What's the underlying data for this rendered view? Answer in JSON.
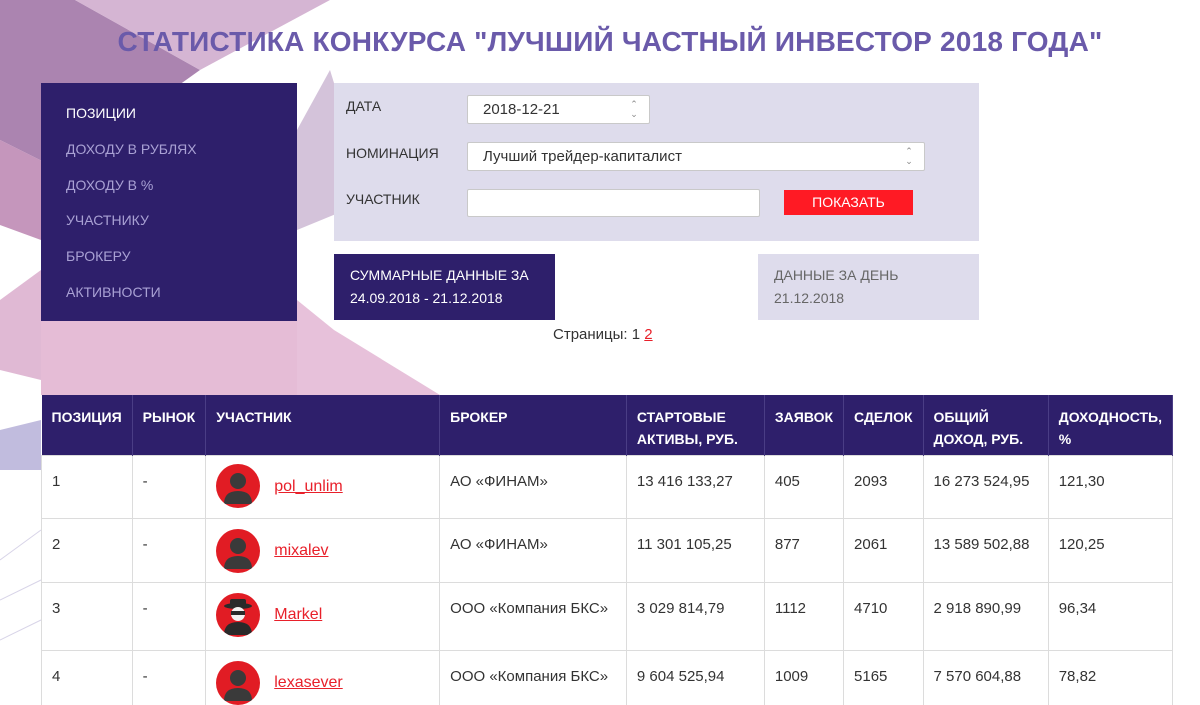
{
  "page_title": "СТАТИСТИКА КОНКУРСА \"ЛУЧШИЙ ЧАСТНЫЙ ИНВЕСТОР 2018 ГОДА\"",
  "sidebar": {
    "items": [
      {
        "label": "ПОЗИЦИИ",
        "active": true
      },
      {
        "label": "ДОХОДУ В РУБЛЯХ",
        "active": false
      },
      {
        "label": "ДОХОДУ В %",
        "active": false
      },
      {
        "label": "УЧАСТНИКУ",
        "active": false
      },
      {
        "label": "БРОКЕРУ",
        "active": false
      },
      {
        "label": "АКТИВНОСТИ",
        "active": false
      }
    ]
  },
  "filters": {
    "date_label": "ДАТА",
    "date_value": "2018-12-21",
    "nomination_label": "НОМИНАЦИЯ",
    "nomination_value": "Лучший трейдер-капиталист",
    "participant_label": "УЧАСТНИК",
    "participant_value": "",
    "show_button": "ПОКАЗАТЬ"
  },
  "tabs": {
    "summary_line1": "СУММАРНЫЕ ДАННЫЕ ЗА",
    "summary_line2": "24.09.2018 - 21.12.2018",
    "day_line1": "ДАННЫЕ ЗА ДЕНЬ",
    "day_line2": "21.12.2018"
  },
  "pager": {
    "label": "Страницы:",
    "current": "1",
    "other": "2"
  },
  "table": {
    "headers": {
      "position": "ПОЗИЦИЯ",
      "market": "РЫНОК",
      "participant": "УЧАСТНИК",
      "broker": "БРОКЕР",
      "start_assets": "СТАРТОВЫЕ АКТИВЫ, РУБ.",
      "orders": "ЗАЯВОК",
      "deals": "СДЕЛОК",
      "total_income": "ОБЩИЙ ДОХОД, РУБ.",
      "yield": "ДОХОДНОСТЬ, %"
    },
    "rows": [
      {
        "position": "1",
        "market": "-",
        "participant": "pol_unlim",
        "broker": "АО «ФИНАМ»",
        "start_assets": "13 416 133,27",
        "orders": "405",
        "deals": "2093",
        "total_income": "16 273 524,95",
        "yield": "121,30"
      },
      {
        "position": "2",
        "market": "-",
        "participant": "mixalev",
        "broker": "АО «ФИНАМ»",
        "start_assets": "11 301 105,25",
        "orders": "877",
        "deals": "2061",
        "total_income": "13 589 502,88",
        "yield": "120,25"
      },
      {
        "position": "3",
        "market": "-",
        "participant": "Markel",
        "broker": "ООО «Компания БКС»",
        "start_assets": "3 029 814,79",
        "orders": "1112",
        "deals": "4710",
        "total_income": "2 918 890,99",
        "yield": "96,34"
      },
      {
        "position": "4",
        "market": "-",
        "participant": "lexasever",
        "broker": "ООО «Компания БКС»",
        "start_assets": "9 604 525,94",
        "orders": "1009",
        "deals": "5165",
        "total_income": "7 570 604,88",
        "yield": "78,82"
      }
    ]
  },
  "colors": {
    "brand_purple": "#2e1f6b",
    "title_purple": "#6a5aaa",
    "panel_lavender": "#dedcec",
    "accent_red": "#ff1a24"
  },
  "icons": {
    "avatar_default": "user-silhouette-icon",
    "avatar_masked": "masked-user-icon",
    "spinner": "spinner-arrows-icon"
  }
}
